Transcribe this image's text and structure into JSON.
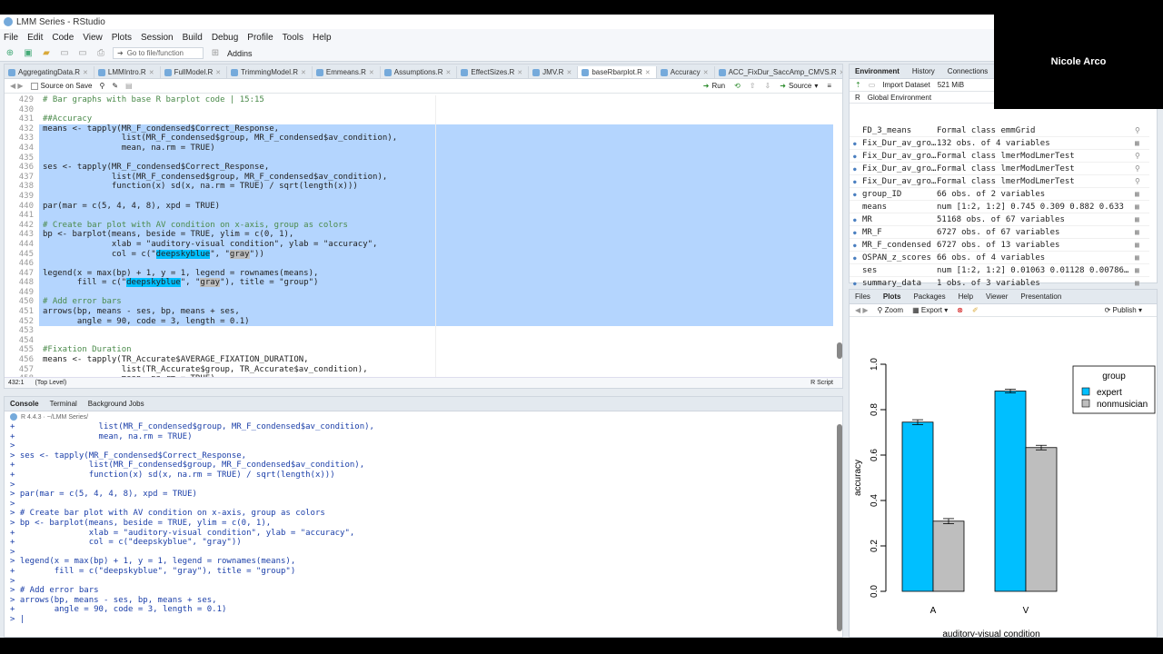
{
  "window": {
    "title": "LMM Series - RStudio"
  },
  "menu": [
    "File",
    "Edit",
    "Code",
    "View",
    "Plots",
    "Session",
    "Build",
    "Debug",
    "Profile",
    "Tools",
    "Help"
  ],
  "toolbar": {
    "goto_placeholder": "Go to file/function",
    "addins": "Addins"
  },
  "file_tabs": [
    "AggregatingData.R",
    "LMMIntro.R",
    "FullModel.R",
    "TrimmingModel.R",
    "Emmeans.R",
    "Assumptions.R",
    "EffectSizes.R",
    "JMV.R",
    "baseRbarplot.R",
    "Accuracy",
    "ACC_FixDur_SaccAmp_CMVS.R"
  ],
  "editor_toolbar": {
    "source_on_save": "Source on Save",
    "run": "Run",
    "source": "Source"
  },
  "editor_lines": [
    {
      "n": "429",
      "t": "# Bar graphs with base R barplot code | 15:15",
      "sel": false
    },
    {
      "n": "430",
      "t": "",
      "sel": false
    },
    {
      "n": "431",
      "t": "##Accuracy",
      "sel": false
    },
    {
      "n": "432",
      "t": "means <- tapply(MR_F_condensed$Correct_Response,",
      "sel": true
    },
    {
      "n": "433",
      "t": "                list(MR_F_condensed$group, MR_F_condensed$av_condition),",
      "sel": true
    },
    {
      "n": "434",
      "t": "                mean, na.rm = TRUE)",
      "sel": true
    },
    {
      "n": "435",
      "t": "",
      "sel": true
    },
    {
      "n": "436",
      "t": "ses <- tapply(MR_F_condensed$Correct_Response,",
      "sel": true
    },
    {
      "n": "437",
      "t": "              list(MR_F_condensed$group, MR_F_condensed$av_condition),",
      "sel": true
    },
    {
      "n": "438",
      "t": "              function(x) sd(x, na.rm = TRUE) / sqrt(length(x)))",
      "sel": true
    },
    {
      "n": "439",
      "t": "",
      "sel": true
    },
    {
      "n": "440",
      "t": "par(mar = c(5, 4, 4, 8), xpd = TRUE)",
      "sel": true
    },
    {
      "n": "441",
      "t": "",
      "sel": true
    },
    {
      "n": "442",
      "t": "# Create bar plot with AV condition on x-axis, group as colors",
      "sel": true
    },
    {
      "n": "443",
      "t": "bp <- barplot(means, beside = TRUE, ylim = c(0, 1),",
      "sel": true
    },
    {
      "n": "444",
      "t": "              xlab = \"auditory-visual condition\", ylab = \"accuracy\",",
      "sel": true
    },
    {
      "n": "445",
      "t": "              col = c(\"deepskyblue\", \"gray\"))",
      "sel": true
    },
    {
      "n": "446",
      "t": "",
      "sel": true
    },
    {
      "n": "447",
      "t": "legend(x = max(bp) + 1, y = 1, legend = rownames(means),",
      "sel": true
    },
    {
      "n": "448",
      "t": "       fill = c(\"deepskyblue\", \"gray\"), title = \"group\")",
      "sel": true
    },
    {
      "n": "449",
      "t": "",
      "sel": true
    },
    {
      "n": "450",
      "t": "# Add error bars",
      "sel": true
    },
    {
      "n": "451",
      "t": "arrows(bp, means - ses, bp, means + ses,",
      "sel": true
    },
    {
      "n": "452",
      "t": "       angle = 90, code = 3, length = 0.1)",
      "sel": true
    },
    {
      "n": "453",
      "t": "",
      "sel": false
    },
    {
      "n": "454",
      "t": "",
      "sel": false
    },
    {
      "n": "455",
      "t": "#Fixation Duration",
      "sel": false
    },
    {
      "n": "456",
      "t": "means <- tapply(TR_Accurate$AVERAGE_FIXATION_DURATION,",
      "sel": false
    },
    {
      "n": "457",
      "t": "                list(TR_Accurate$group, TR_Accurate$av_condition),",
      "sel": false
    },
    {
      "n": "458",
      "t": "                mean, na.rm = TRUE)",
      "sel": false
    }
  ],
  "status_bar": {
    "position": "432:1",
    "scope": "(Top Level)",
    "type": "R Script"
  },
  "console_tabs": [
    "Console",
    "Terminal",
    "Background Jobs"
  ],
  "console_info": "R 4.4.3 · ~/LMM Series/",
  "console_lines": [
    "+                 list(MR_F_condensed$group, MR_F_condensed$av_condition),",
    "+                 mean, na.rm = TRUE)",
    ">",
    "> ses <- tapply(MR_F_condensed$Correct_Response,",
    "+               list(MR_F_condensed$group, MR_F_condensed$av_condition),",
    "+               function(x) sd(x, na.rm = TRUE) / sqrt(length(x)))",
    ">",
    "> par(mar = c(5, 4, 4, 8), xpd = TRUE)",
    ">",
    "> # Create bar plot with AV condition on x-axis, group as colors",
    "> bp <- barplot(means, beside = TRUE, ylim = c(0, 1),",
    "+               xlab = \"auditory-visual condition\", ylab = \"accuracy\",",
    "+               col = c(\"deepskyblue\", \"gray\"))",
    ">",
    "> legend(x = max(bp) + 1, y = 1, legend = rownames(means),",
    "+        fill = c(\"deepskyblue\", \"gray\"), title = \"group\")",
    ">",
    "> # Add error bars",
    "> arrows(bp, means - ses, bp, means + ses,",
    "+        angle = 90, code = 3, length = 0.1)",
    "> |"
  ],
  "env_tabs": [
    "Environment",
    "History",
    "Connections"
  ],
  "env_toolbar": {
    "import": "Import Dataset",
    "memory": "521 MiB",
    "scope": "Global Environment",
    "lang": "R"
  },
  "env_rows": [
    {
      "name": "FD_3_means",
      "value": "Formal class  emmGrid",
      "expand": false
    },
    {
      "name": "Fix_Dur_av_gro…",
      "value": "132 obs. of 4 variables",
      "expand": true
    },
    {
      "name": "Fix_Dur_av_gro…",
      "value": "Formal class  lmerModLmerTest",
      "expand": true
    },
    {
      "name": "Fix_Dur_av_gro…",
      "value": "Formal class  lmerModLmerTest",
      "expand": true
    },
    {
      "name": "Fix_Dur_av_gro…",
      "value": "Formal class  lmerModLmerTest",
      "expand": true
    },
    {
      "name": "group_ID",
      "value": "66 obs. of 2 variables",
      "expand": true
    },
    {
      "name": "means",
      "value": "num [1:2, 1:2] 0.745 0.309 0.882 0.633",
      "expand": false
    },
    {
      "name": "MR",
      "value": "51168 obs. of 67 variables",
      "expand": true
    },
    {
      "name": "MR_F",
      "value": "6727 obs. of 67 variables",
      "expand": true
    },
    {
      "name": "MR_F_condensed",
      "value": "6727 obs. of 13 variables",
      "expand": true
    },
    {
      "name": "OSPAN_z_scores",
      "value": "66 obs. of 4 variables",
      "expand": true
    },
    {
      "name": "ses",
      "value": "num [1:2, 1:2] 0.01063 0.01128 0.00786…",
      "expand": false
    },
    {
      "name": "summary_data",
      "value": "1 obs. of 3 variables",
      "expand": true
    }
  ],
  "plots_tabs": [
    "Files",
    "Plots",
    "Packages",
    "Help",
    "Viewer",
    "Presentation"
  ],
  "plots_toolbar": {
    "zoom": "Zoom",
    "export": "Export",
    "publish": "Publish"
  },
  "video": {
    "name": "Nicole Arco"
  },
  "colors": {
    "expert": "#00bfff",
    "nonmusician": "#bebebe",
    "selection": "#b4d5fe"
  },
  "chart_data": {
    "type": "bar",
    "categories": [
      "A",
      "V"
    ],
    "series": [
      {
        "name": "expert",
        "values": [
          0.745,
          0.882
        ],
        "se": [
          0.01063,
          0.00786
        ]
      },
      {
        "name": "nonmusician",
        "values": [
          0.309,
          0.633
        ],
        "se": [
          0.01128,
          0.01
        ]
      }
    ],
    "xlabel": "auditory-visual condition",
    "ylabel": "accuracy",
    "ylim": [
      0,
      1
    ],
    "yticks": [
      "0.0",
      "0.2",
      "0.4",
      "0.6",
      "0.8",
      "1.0"
    ],
    "legend_title": "group",
    "legend_position": "top-right",
    "grid": false
  }
}
